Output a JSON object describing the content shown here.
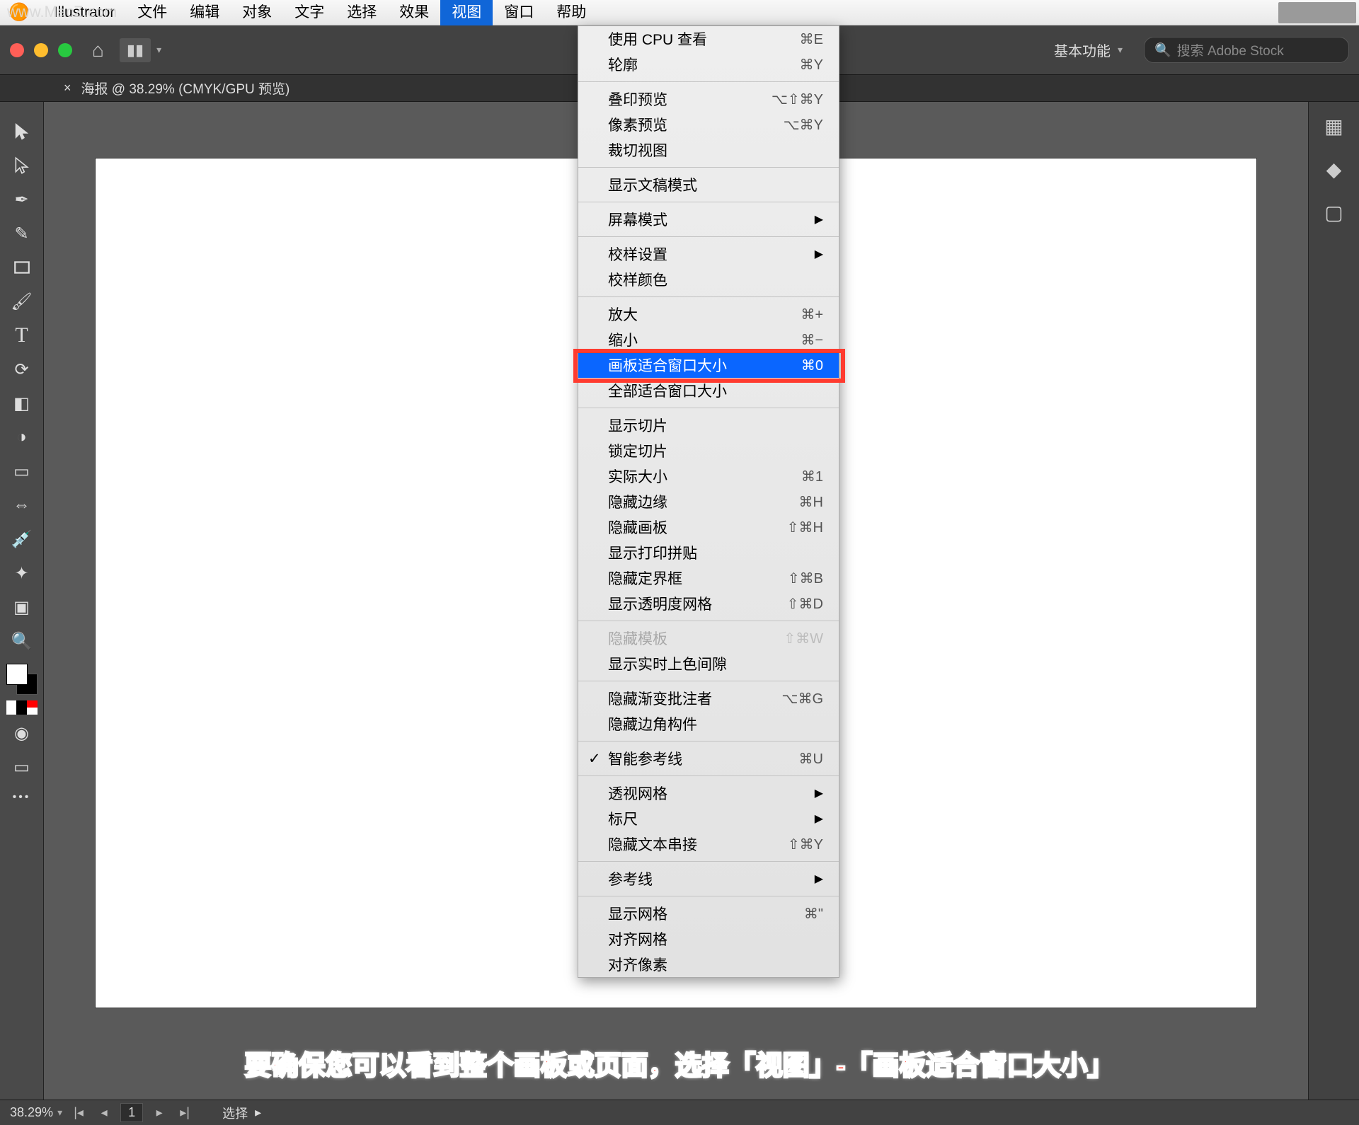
{
  "watermark": "www.MacZ.com",
  "menubar": {
    "app": "Illustrator",
    "items": [
      "文件",
      "编辑",
      "对象",
      "文字",
      "选择",
      "效果",
      "视图",
      "窗口",
      "帮助"
    ],
    "active_index": 6
  },
  "apptoolbar": {
    "workspace": "基本功能",
    "search_placeholder": "搜索 Adobe Stock"
  },
  "tab": {
    "title": "海报 @ 38.29% (CMYK/GPU 预览)"
  },
  "dropdown": {
    "groups": [
      [
        {
          "label": "使用 CPU 查看",
          "shortcut": "⌘E"
        },
        {
          "label": "轮廓",
          "shortcut": "⌘Y"
        }
      ],
      [
        {
          "label": "叠印预览",
          "shortcut": "⌥⇧⌘Y"
        },
        {
          "label": "像素预览",
          "shortcut": "⌥⌘Y"
        },
        {
          "label": "裁切视图",
          "shortcut": ""
        }
      ],
      [
        {
          "label": "显示文稿模式",
          "shortcut": ""
        }
      ],
      [
        {
          "label": "屏幕模式",
          "submenu": true
        }
      ],
      [
        {
          "label": "校样设置",
          "submenu": true
        },
        {
          "label": "校样颜色",
          "shortcut": ""
        }
      ],
      [
        {
          "label": "放大",
          "shortcut": "⌘+"
        },
        {
          "label": "缩小",
          "shortcut": "⌘−"
        },
        {
          "label": "画板适合窗口大小",
          "shortcut": "⌘0",
          "highlight": true
        },
        {
          "label": "全部适合窗口大小",
          "shortcut": ""
        }
      ],
      [
        {
          "label": "显示切片",
          "shortcut": ""
        },
        {
          "label": "锁定切片",
          "shortcut": ""
        },
        {
          "label": "实际大小",
          "shortcut": "⌘1"
        },
        {
          "label": "隐藏边缘",
          "shortcut": "⌘H"
        },
        {
          "label": "隐藏画板",
          "shortcut": "⇧⌘H"
        },
        {
          "label": "显示打印拼贴",
          "shortcut": ""
        },
        {
          "label": "隐藏定界框",
          "shortcut": "⇧⌘B"
        },
        {
          "label": "显示透明度网格",
          "shortcut": "⇧⌘D"
        }
      ],
      [
        {
          "label": "隐藏模板",
          "shortcut": "⇧⌘W",
          "disabled": true
        },
        {
          "label": "显示实时上色间隙",
          "shortcut": ""
        }
      ],
      [
        {
          "label": "隐藏渐变批注者",
          "shortcut": "⌥⌘G"
        },
        {
          "label": "隐藏边角构件",
          "shortcut": ""
        }
      ],
      [
        {
          "label": "智能参考线",
          "shortcut": "⌘U",
          "checked": true
        }
      ],
      [
        {
          "label": "透视网格",
          "submenu": true
        },
        {
          "label": "标尺",
          "submenu": true
        },
        {
          "label": "隐藏文本串接",
          "shortcut": "⇧⌘Y"
        }
      ],
      [
        {
          "label": "参考线",
          "submenu": true
        }
      ],
      [
        {
          "label": "显示网格",
          "shortcut": "⌘\""
        },
        {
          "label": "对齐网格",
          "shortcut": ""
        },
        {
          "label": "对齐像素",
          "shortcut": ""
        }
      ]
    ]
  },
  "statusbar": {
    "zoom": "38.29%",
    "artboard_nav_label": "1",
    "mode": "选择"
  },
  "caption": "要确保您可以看到整个画板或页面，选择「视图」-「画板适合窗口大小」"
}
